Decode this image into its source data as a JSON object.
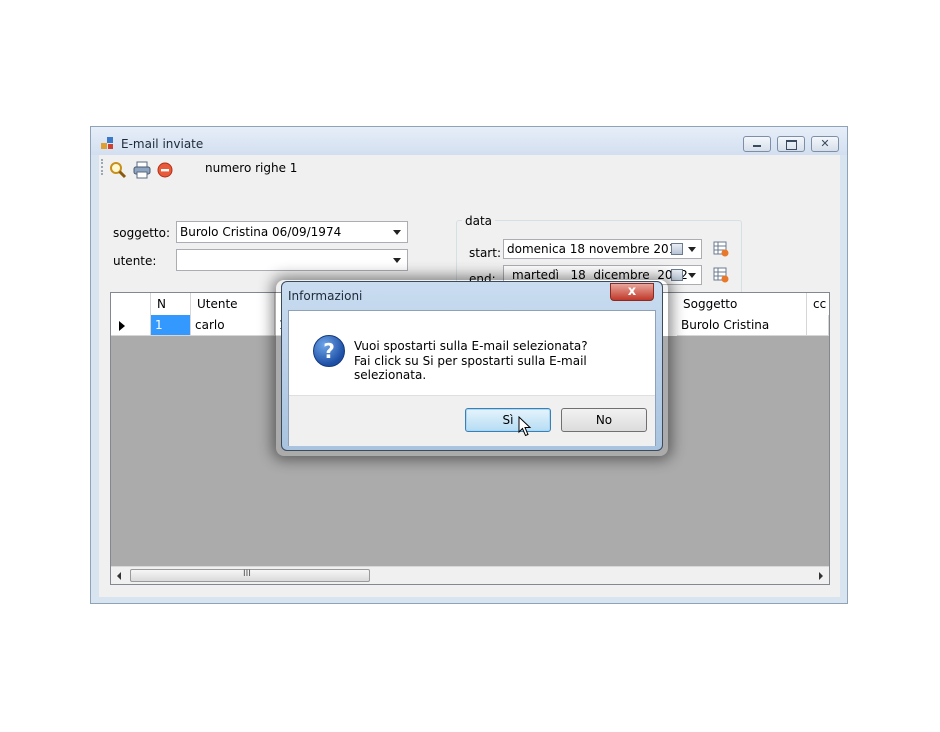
{
  "window": {
    "title": "E-mail inviate"
  },
  "toolbar": {
    "icons": [
      "search-icon",
      "print-icon",
      "stop-icon"
    ],
    "rows_label": "numero righe 1"
  },
  "filters": {
    "soggetto_label": "soggetto:",
    "soggetto_value": "Burolo Cristina 06/09/1974",
    "utente_label": "utente:",
    "utente_value": "",
    "data_group_title": "data",
    "start_label": "start:",
    "start_value": "domenica 18 novembre 2012",
    "end_label": "end:",
    "end_value": "martedì   18  dicembre  2012"
  },
  "grid": {
    "columns": [
      "N",
      "Utente",
      "Soggetto",
      "cc"
    ],
    "rows": [
      {
        "n": "1",
        "utente": "carlo",
        "col3": "1",
        "soggetto": "Burolo Cristina",
        "cc": ""
      }
    ],
    "scroll_thumb_label": "III"
  },
  "dialog": {
    "title": "Informazioni",
    "close_label": "x",
    "icon": "question-icon",
    "message_line1": "Vuoi spostarti sulla E-mail selezionata?",
    "message_line2": "Fai click su Si per spostarti sulla E-mail selezionata.",
    "yes_label": "Sì",
    "no_label": "No"
  },
  "colors": {
    "selected_cell": "#3399ff",
    "grid_background": "#ababab",
    "dialog_frame": "#b5cde8"
  }
}
